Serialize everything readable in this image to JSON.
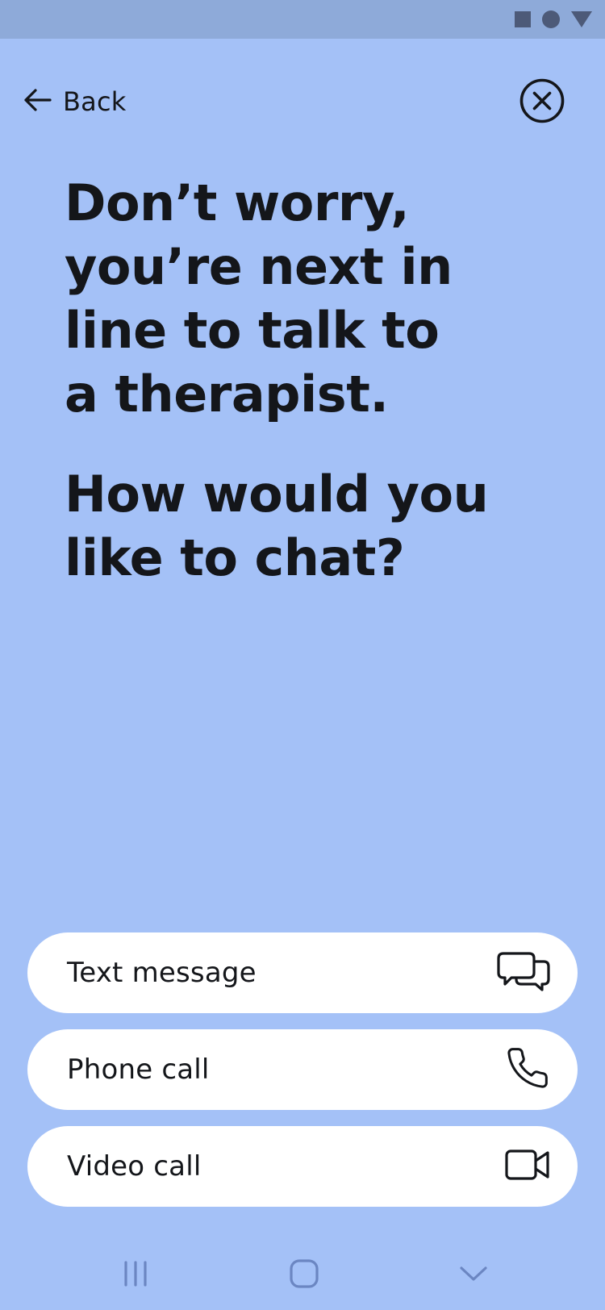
{
  "header": {
    "back_label": "Back"
  },
  "main": {
    "headline_lines": [
      "Don’t worry,",
      "you’re next in",
      "line to talk to",
      "a therapist."
    ],
    "question_lines": [
      "How would you",
      "like to chat?"
    ]
  },
  "options": [
    {
      "label": "Text message",
      "icon": "chat-bubbles-icon"
    },
    {
      "label": "Phone call",
      "icon": "phone-icon"
    },
    {
      "label": "Video call",
      "icon": "video-camera-icon"
    }
  ],
  "colors": {
    "background": "#a4c1f7",
    "status_bar": "#8eaad9",
    "button": "#ffffff",
    "text": "#14161a"
  }
}
